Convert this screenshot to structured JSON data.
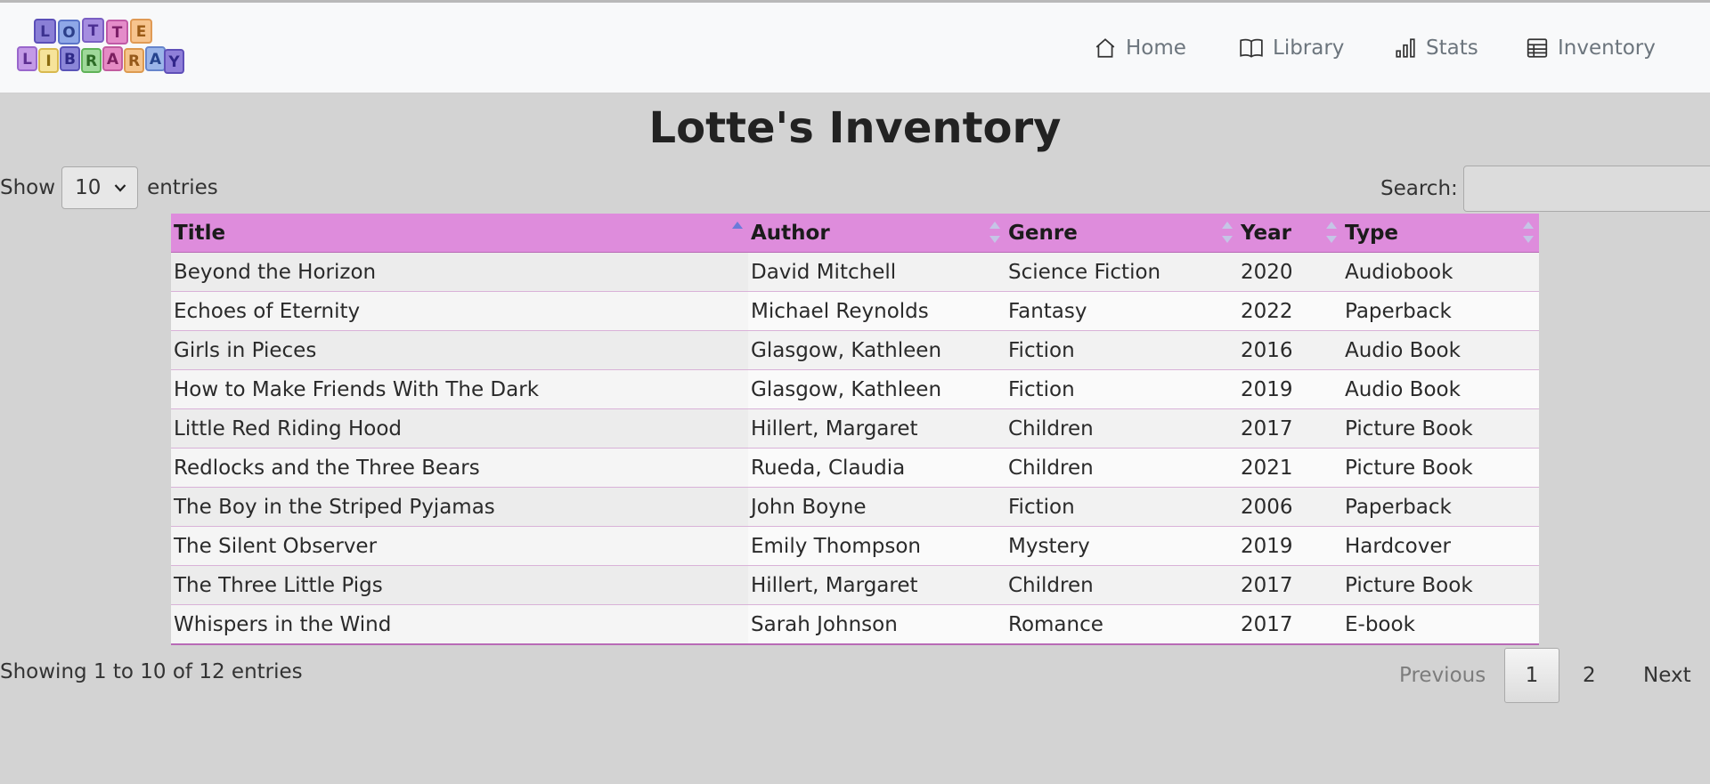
{
  "nav": {
    "logo_text": "LOTTE LIBRARY",
    "items": [
      {
        "label": "Home",
        "icon": "house-icon"
      },
      {
        "label": "Library",
        "icon": "book-icon"
      },
      {
        "label": "Stats",
        "icon": "bar-chart-icon"
      },
      {
        "label": "Inventory",
        "icon": "table-icon"
      }
    ]
  },
  "page": {
    "title": "Lotte's Inventory"
  },
  "controls": {
    "show_label": "Show",
    "page_size": "10",
    "entries_label": "entries",
    "search_label": "Search:",
    "search_value": ""
  },
  "table": {
    "columns": [
      "Title",
      "Author",
      "Genre",
      "Year",
      "Type"
    ],
    "sorted_column": "Title",
    "sort_direction": "ascending",
    "rows": [
      [
        "Beyond the Horizon",
        "David Mitchell",
        "Science Fiction",
        "2020",
        "Audiobook"
      ],
      [
        "Echoes of Eternity",
        "Michael Reynolds",
        "Fantasy",
        "2022",
        "Paperback"
      ],
      [
        "Girls in Pieces",
        "Glasgow, Kathleen",
        "Fiction",
        "2016",
        "Audio Book"
      ],
      [
        "How to Make Friends With The Dark",
        "Glasgow, Kathleen",
        "Fiction",
        "2019",
        "Audio Book"
      ],
      [
        "Little Red Riding Hood",
        "Hillert, Margaret",
        "Children",
        "2017",
        "Picture Book"
      ],
      [
        "Redlocks and the Three Bears",
        "Rueda, Claudia",
        "Children",
        "2021",
        "Picture Book"
      ],
      [
        "The Boy in the Striped Pyjamas",
        "John Boyne",
        "Fiction",
        "2006",
        "Paperback"
      ],
      [
        "The Silent Observer",
        "Emily Thompson",
        "Mystery",
        "2019",
        "Hardcover"
      ],
      [
        "The Three Little Pigs",
        "Hillert, Margaret",
        "Children",
        "2017",
        "Picture Book"
      ],
      [
        "Whispers in the Wind",
        "Sarah Johnson",
        "Romance",
        "2017",
        "E-book"
      ]
    ]
  },
  "footer": {
    "info": "Showing 1 to 10 of 12 entries",
    "previous": "Previous",
    "pages": [
      "1",
      "2"
    ],
    "current_page": "1",
    "next": "Next"
  },
  "colors": {
    "header_bg": "#de8cdc",
    "page_bg": "#d3d3d3",
    "navbar_bg": "#f8f9fa"
  }
}
